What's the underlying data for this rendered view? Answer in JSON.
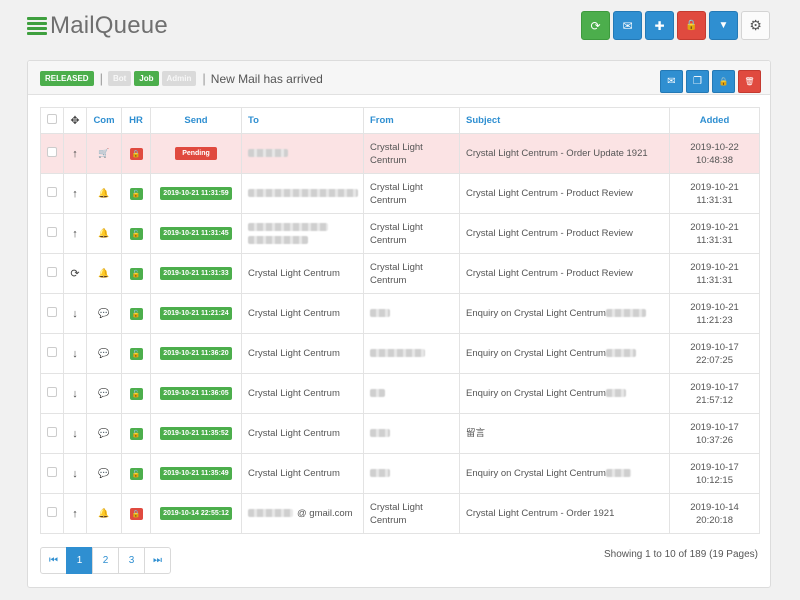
{
  "app": {
    "title": "MailQueue"
  },
  "toolbar": {
    "buttons": [
      {
        "name": "refresh-button",
        "icon": "refresh-icon",
        "glyph": "⟳",
        "color": "#4cae4c"
      },
      {
        "name": "mail-button",
        "icon": "envelope-icon",
        "glyph": "✉",
        "color": "#2f8fd1"
      },
      {
        "name": "add-button",
        "icon": "plus-icon",
        "glyph": "✚",
        "color": "#2f8fd1"
      },
      {
        "name": "lock-button",
        "icon": "lock-icon",
        "glyph": "🔒",
        "color": "#e04a3f"
      },
      {
        "name": "filter-button",
        "icon": "filter-icon",
        "glyph": "▼",
        "color": "#2f8fd1"
      },
      {
        "name": "settings-button",
        "icon": "gears-icon",
        "glyph": "⚙",
        "color": "#fbfbfb"
      }
    ]
  },
  "status": {
    "released": "RELEASED",
    "bot": "Bot",
    "job": "Job",
    "admin": "Admin",
    "separator": "|",
    "message": "New Mail has arrived"
  },
  "panel_actions": [
    {
      "name": "panel-mail-button",
      "icon": "envelope-icon",
      "glyph": "✉"
    },
    {
      "name": "panel-copy-button",
      "icon": "copy-icon",
      "glyph": "❐"
    },
    {
      "name": "panel-lock-button",
      "icon": "lock-icon",
      "glyph": "🔒"
    },
    {
      "name": "panel-delete-button",
      "icon": "trash-icon",
      "glyph": "🗑"
    }
  ],
  "table": {
    "headers": {
      "com": "Com",
      "hr": "HR",
      "send": "Send",
      "to": "To",
      "from": "From",
      "subject": "Subject",
      "added": "Added"
    },
    "rows": [
      {
        "dir": "↑",
        "dir_icon": "arrow-up-icon",
        "com": "🛒",
        "com_icon": "cart-icon",
        "hr": "r",
        "send": "Pending",
        "send_type": "pending",
        "to": "",
        "from": "Crystal Light Centrum",
        "subject": "Crystal Light Centrum - Order Update 1921",
        "added_date": "2019-10-22",
        "added_time": "10:48:38"
      },
      {
        "dir": "↑",
        "dir_icon": "arrow-up-icon",
        "com": "🔔",
        "com_icon": "bell-icon",
        "hr": "g",
        "send": "2019-10-21 11:31:59",
        "send_type": "date",
        "to": "",
        "from": "Crystal Light Centrum",
        "subject": "Crystal Light Centrum - Product Review",
        "added_date": "2019-10-21",
        "added_time": "11:31:31"
      },
      {
        "dir": "↑",
        "dir_icon": "arrow-up-icon",
        "com": "🔔",
        "com_icon": "bell-icon",
        "hr": "g",
        "send": "2019-10-21 11:31:45",
        "send_type": "date",
        "to": "",
        "from": "Crystal Light Centrum",
        "subject": "Crystal Light Centrum - Product Review",
        "added_date": "2019-10-21",
        "added_time": "11:31:31"
      },
      {
        "dir": "⟳",
        "dir_icon": "refresh-icon",
        "com": "🔔",
        "com_icon": "bell-icon",
        "hr": "g",
        "send": "2019-10-21 11:31:33",
        "send_type": "date",
        "to": "Crystal Light Centrum",
        "from": "Crystal Light Centrum",
        "subject": "Crystal Light Centrum - Product Review",
        "added_date": "2019-10-21",
        "added_time": "11:31:31"
      },
      {
        "dir": "↓",
        "dir_icon": "arrow-down-icon",
        "com": "💬",
        "com_icon": "comments-icon",
        "hr": "g",
        "send": "2019-10-21 11:21:24",
        "send_type": "date",
        "to": "Crystal Light Centrum",
        "from": "",
        "subject": "Enquiry on Crystal Light Centrum",
        "added_date": "2019-10-21",
        "added_time": "11:21:23"
      },
      {
        "dir": "↓",
        "dir_icon": "arrow-down-icon",
        "com": "💬",
        "com_icon": "comments-icon",
        "hr": "g",
        "send": "2019-10-21 11:36:20",
        "send_type": "date",
        "to": "Crystal Light Centrum",
        "from": "",
        "subject": "Enquiry on Crystal Light Centrum",
        "added_date": "2019-10-17",
        "added_time": "22:07:25"
      },
      {
        "dir": "↓",
        "dir_icon": "arrow-down-icon",
        "com": "💬",
        "com_icon": "comments-icon",
        "hr": "g",
        "send": "2019-10-21 11:36:05",
        "send_type": "date",
        "to": "Crystal Light Centrum",
        "from": "",
        "subject": "Enquiry on Crystal Light Centrum",
        "added_date": "2019-10-17",
        "added_time": "21:57:12"
      },
      {
        "dir": "↓",
        "dir_icon": "arrow-down-icon",
        "com": "💬",
        "com_icon": "comments-icon",
        "hr": "g",
        "send": "2019-10-21 11:35:52",
        "send_type": "date",
        "to": "Crystal Light Centrum",
        "from": "",
        "subject": "留言",
        "added_date": "2019-10-17",
        "added_time": "10:37:26"
      },
      {
        "dir": "↓",
        "dir_icon": "arrow-down-icon",
        "com": "💬",
        "com_icon": "comments-icon",
        "hr": "g",
        "send": "2019-10-21 11:35:49",
        "send_type": "date",
        "to": "Crystal Light Centrum",
        "from": "",
        "subject": "Enquiry on Crystal Light Centrum",
        "added_date": "2019-10-17",
        "added_time": "10:12:15"
      },
      {
        "dir": "↑",
        "dir_icon": "arrow-up-icon",
        "com": "🔔",
        "com_icon": "bell-icon",
        "hr": "r",
        "send": "2019-10-14 22:55:12",
        "send_type": "date",
        "to": "@ gmail.com",
        "from": "Crystal Light Centrum",
        "subject": "Crystal Light Centrum - Order 1921",
        "added_date": "2019-10-14",
        "added_time": "20:20:18"
      }
    ]
  },
  "pagination": {
    "first": "⏮",
    "pages": [
      "1",
      "2",
      "3"
    ],
    "active": "1",
    "last": "⏭",
    "summary": "Showing 1 to 10 of 189 (19 Pages)"
  },
  "colors": {
    "green": "#4cae4c",
    "blue": "#2f8fd1",
    "red": "#e04a3f",
    "pending_row": "#fbe3e4"
  }
}
